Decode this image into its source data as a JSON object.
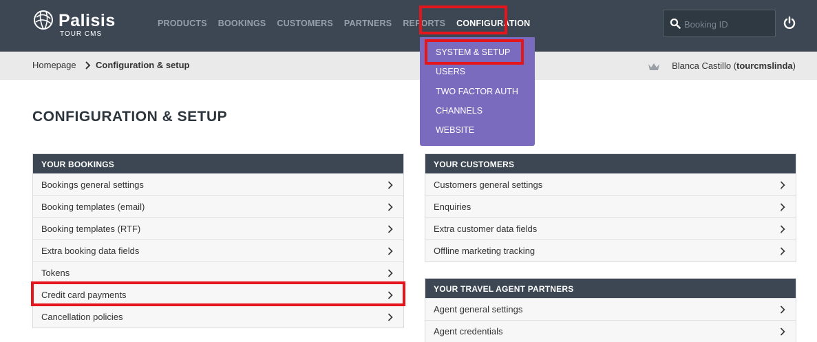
{
  "brand": {
    "name": "Palisis",
    "sub": "TOUR CMS"
  },
  "nav": [
    {
      "label": "PRODUCTS"
    },
    {
      "label": "BOOKINGS"
    },
    {
      "label": "CUSTOMERS"
    },
    {
      "label": "PARTNERS"
    },
    {
      "label": "REPORTS"
    },
    {
      "label": "CONFIGURATION"
    }
  ],
  "search": {
    "placeholder": "Booking ID",
    "value": ""
  },
  "icons": {
    "search": "search-icon",
    "power": "power-icon",
    "crown": "crown-icon",
    "chevron": "chevron-right-icon"
  },
  "breadcrumb": {
    "home": "Homepage",
    "current": "Configuration & setup"
  },
  "user": {
    "name": "Blanca Castillo",
    "username": "tourcmslinda"
  },
  "dropdown": [
    {
      "label": "SYSTEM & SETUP"
    },
    {
      "label": "USERS"
    },
    {
      "label": "TWO FACTOR AUTH"
    },
    {
      "label": "CHANNELS"
    },
    {
      "label": "WEBSITE"
    }
  ],
  "page_title": "CONFIGURATION & SETUP",
  "panels": {
    "bookings": {
      "title": "YOUR BOOKINGS",
      "items": [
        "Bookings general settings",
        "Booking templates (email)",
        "Booking templates (RTF)",
        "Extra booking data fields",
        "Tokens",
        "Credit card payments",
        "Cancellation policies"
      ]
    },
    "customers": {
      "title": "YOUR CUSTOMERS",
      "items": [
        "Customers general settings",
        "Enquiries",
        "Extra customer data fields",
        "Offline marketing tracking"
      ]
    },
    "agents": {
      "title": "YOUR TRAVEL AGENT PARTNERS",
      "items": [
        "Agent general settings",
        "Agent credentials"
      ]
    }
  },
  "colors": {
    "header": "#3c4753",
    "dropdown": "#7b6bbf",
    "highlight": "#e4151b",
    "breadcrumb_bg": "#eaeaeb"
  }
}
